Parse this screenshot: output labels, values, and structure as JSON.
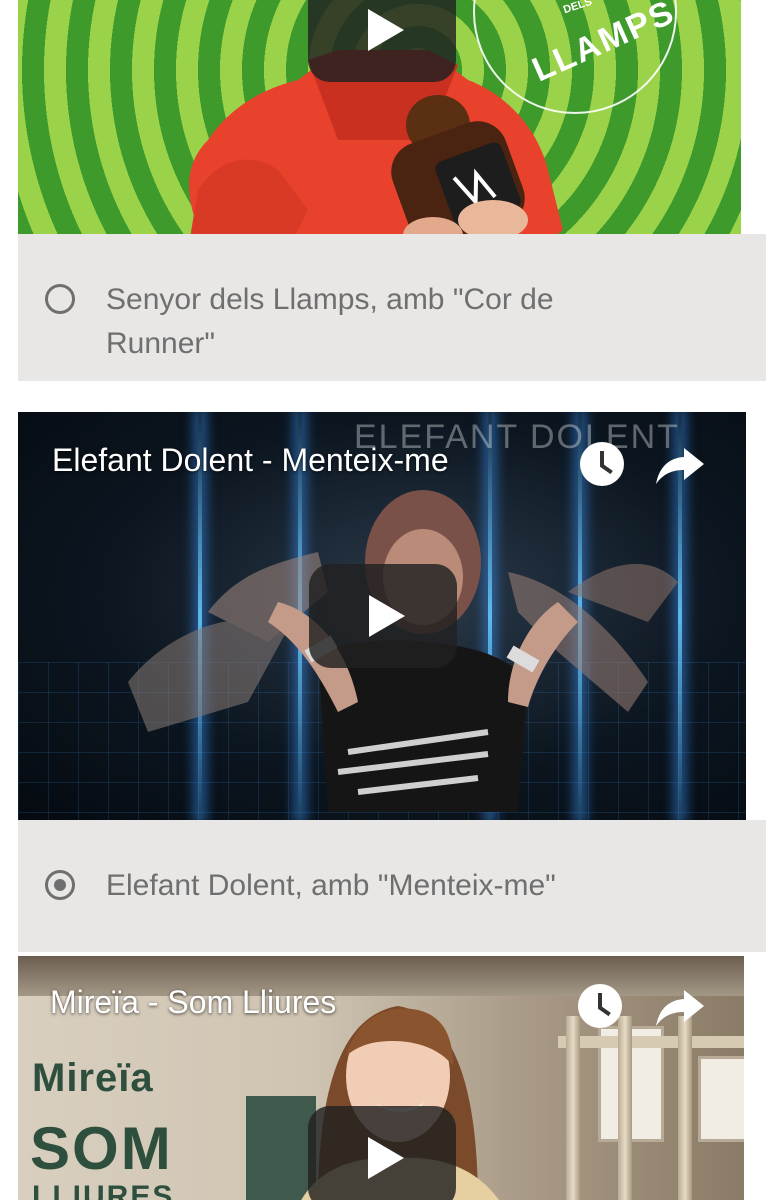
{
  "videos": [
    {
      "title": "",
      "badge": {
        "small_text": "DELS",
        "big_text": "LLAMPS"
      }
    },
    {
      "title": "Elefant Dolent - Menteix-me",
      "watermark": "ELEFANT DOLENT"
    },
    {
      "title": "Mireïa - Som Lliures",
      "logo": {
        "name": "Mireïa",
        "line1": "SOM",
        "line2": "LLIURES"
      }
    }
  ],
  "options": [
    {
      "label": "Senyor dels Llamps, amb \"Cor de Runner\"",
      "selected": false
    },
    {
      "label": "Elefant Dolent, amb \"Menteix-me\"",
      "selected": true
    }
  ],
  "icons": {
    "play": "play-icon",
    "watch_later": "clock-icon",
    "share": "share-arrow-icon",
    "radio_off": "radio-unchecked-icon",
    "radio_on": "radio-checked-icon"
  },
  "colors": {
    "option_bg": "#e8e7e5",
    "option_text": "#6f6f6f",
    "play_bg": "#212121"
  }
}
